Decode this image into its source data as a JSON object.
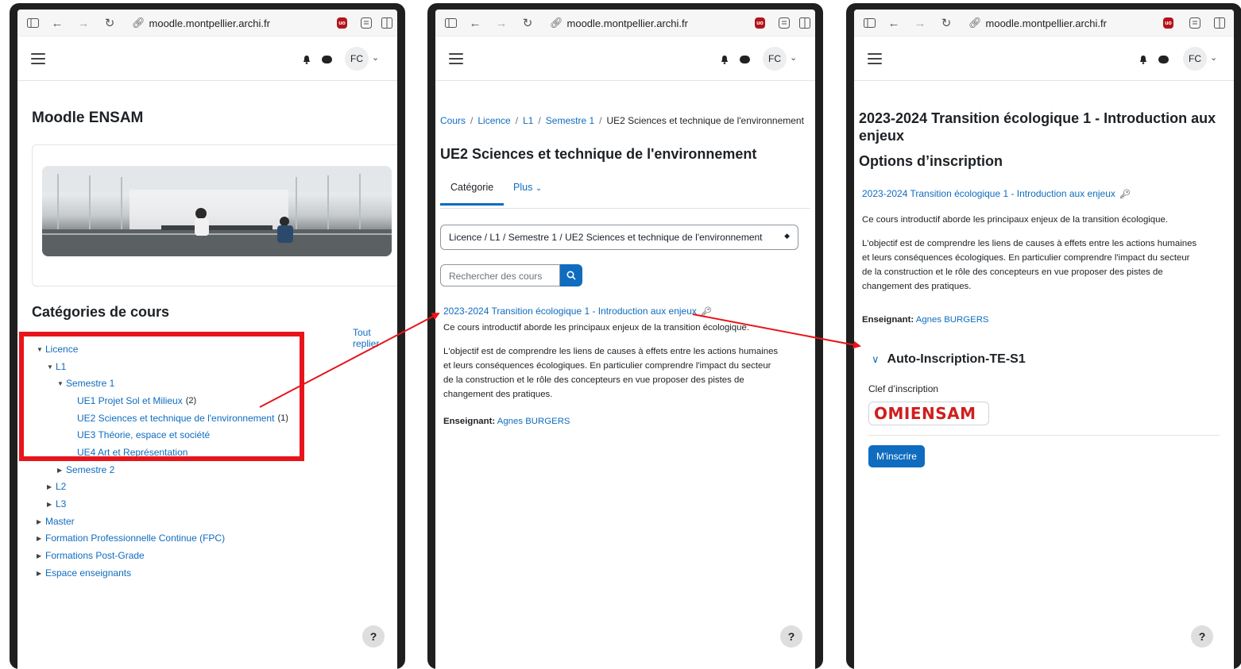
{
  "browser": {
    "url": "moodle.montpellier.archi.fr",
    "avatar_initials": "FC",
    "help_label": "?",
    "icons": [
      "sidebar-icon",
      "back-icon",
      "forward-icon",
      "reload-icon",
      "link-icon",
      "ublock-shield-icon",
      "reader-icon",
      "split-view-icon",
      "hamburger-menu-icon",
      "bell-icon",
      "chat-icon",
      "chevron-down-icon"
    ]
  },
  "panel1": {
    "site_title": "Moodle ENSAM",
    "categories_heading": "Catégories de cours",
    "collapse_all": "Tout replier",
    "tree": [
      {
        "label": "Licence",
        "expanded": true,
        "count": ""
      },
      {
        "label": "L1",
        "expanded": true,
        "count": ""
      },
      {
        "label": "Semestre 1",
        "expanded": true,
        "count": ""
      },
      {
        "label": "UE1 Projet Sol et Milieux",
        "count": "(2)"
      },
      {
        "label": "UE2 Sciences et technique de l'environnement",
        "count": "(1)"
      },
      {
        "label": "UE3 Théorie, espace et société",
        "count": ""
      },
      {
        "label": "UE4 Art et Représentation",
        "count": ""
      },
      {
        "label": "Semestre 2",
        "expanded": false,
        "count": ""
      },
      {
        "label": "L2",
        "expanded": false,
        "count": ""
      },
      {
        "label": "L3",
        "expanded": false,
        "count": ""
      },
      {
        "label": "Master",
        "expanded": false,
        "count": ""
      },
      {
        "label": "Formation Professionnelle Continue (FPC)",
        "expanded": false,
        "count": ""
      },
      {
        "label": "Formations Post-Grade",
        "expanded": false,
        "count": ""
      },
      {
        "label": "Espace enseignants",
        "expanded": false,
        "count": ""
      }
    ]
  },
  "panel2": {
    "breadcrumb": [
      "Cours",
      "Licence",
      "L1",
      "Semestre 1",
      "UE2 Sciences et technique de l'environnement"
    ],
    "page_title": "UE2 Sciences et technique de l'environnement",
    "tabs": {
      "category": "Catégorie",
      "more": "Plus"
    },
    "category_select": "Licence / L1 / Semestre 1 / UE2 Sciences et technique de l'environnement",
    "search_placeholder": "Rechercher des cours",
    "course_link": "2023-2024 Transition écologique 1 - Introduction aux enjeux",
    "summary1": "Ce cours introductif aborde les principaux enjeux de la transition écologique.",
    "summary2_lines": [
      "L'objectif est de comprendre les liens de causes à effets entre les actions humaines",
      "et leurs conséquences écologiques. En particulier comprendre l'impact du secteur",
      "de la construction et le rôle des concepteurs en vue proposer des pistes de",
      "changement des pratiques."
    ],
    "teacher_label": "Enseignant:",
    "teacher_name": "Agnes BURGERS"
  },
  "panel3": {
    "course_title_lines": [
      "2023-2024 Transition écologique 1 - Introduction aux",
      "enjeux"
    ],
    "options_heading": "Options d’inscription",
    "course_link": "2023-2024 Transition écologique 1 - Introduction aux enjeux",
    "summary1": "Ce cours introductif aborde les principaux enjeux de la transition écologique.",
    "summary2_lines": [
      "L'objectif est de comprendre les liens de causes à effets entre les actions humaines",
      "et leurs conséquences écologiques. En particulier comprendre l'impact du secteur",
      "de la construction et le rôle des concepteurs en vue proposer des pistes de",
      "changement des pratiques."
    ],
    "teacher_label": "Enseignant:",
    "teacher_name": "Agnes BURGERS",
    "enrol_method": "Auto-Inscription-TE-S1",
    "enrol_key_label": "Clef d’inscription",
    "enrol_key_value": "OMIENSAM",
    "enrol_button": "M'inscrire"
  },
  "colors": {
    "link": "#0f6cbf",
    "annotation_red": "#e8141b",
    "primary_button": "#0f6cbf"
  }
}
